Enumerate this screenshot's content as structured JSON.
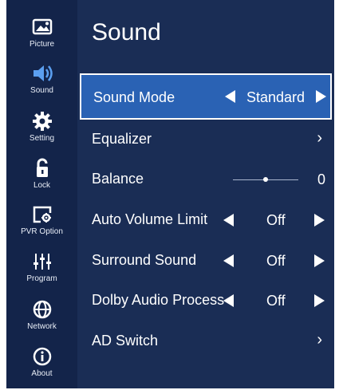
{
  "screen": {
    "title": "Sound"
  },
  "sidebar": {
    "items": [
      {
        "label": "Picture",
        "icon": "picture-icon"
      },
      {
        "label": "Sound",
        "icon": "speaker-icon"
      },
      {
        "label": "Setting",
        "icon": "gear-icon"
      },
      {
        "label": "Lock",
        "icon": "lock-icon"
      },
      {
        "label": "PVR Option",
        "icon": "pvr-icon"
      },
      {
        "label": "Program",
        "icon": "program-sliders-icon"
      },
      {
        "label": "Network",
        "icon": "globe-icon"
      },
      {
        "label": "About",
        "icon": "info-icon"
      }
    ],
    "active": "Sound"
  },
  "menu": {
    "sound_mode": {
      "label": "Sound Mode",
      "value": "Standard"
    },
    "equalizer": {
      "label": "Equalizer",
      "chevron": "›"
    },
    "balance": {
      "label": "Balance",
      "value": "0",
      "level": 0.5
    },
    "auto_volume_limit": {
      "label": "Auto Volume Limit",
      "value": "Off"
    },
    "surround_sound": {
      "label": "Surround Sound",
      "value": "Off"
    },
    "dolby_audio": {
      "label": "Dolby Audio Process",
      "value": "Off"
    },
    "ad_switch": {
      "label": "AD Switch",
      "chevron": "›"
    }
  },
  "colors": {
    "background": "#1a2d55",
    "sidebar": "#13244a",
    "selected": "#2a62b4",
    "text": "#ffffff"
  }
}
